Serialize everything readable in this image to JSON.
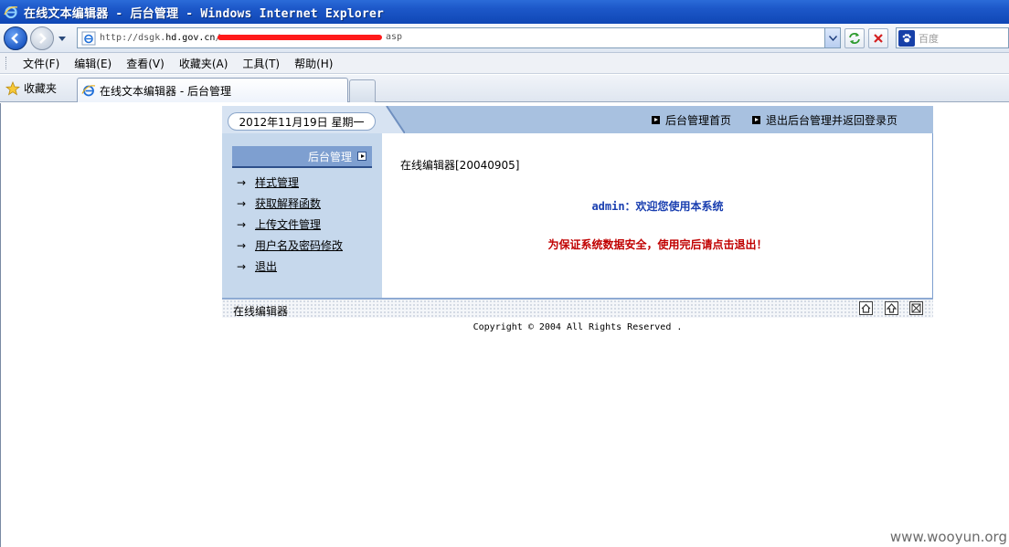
{
  "window": {
    "title": "在线文本编辑器 - 后台管理 - Windows Internet Explorer"
  },
  "address_bar": {
    "url_prefix": "http://dsgk.",
    "url_host": "hd.gov.cn",
    "url_slash": "/",
    "url_suffix": "asp",
    "search_placeholder": "百度"
  },
  "menu": {
    "items": [
      "文件(F)",
      "编辑(E)",
      "查看(V)",
      "收藏夹(A)",
      "工具(T)",
      "帮助(H)"
    ]
  },
  "tabs": {
    "favorites_label": "收藏夹",
    "active_tab_label": "在线文本编辑器 - 后台管理"
  },
  "page": {
    "date": "2012年11月19日  星期一",
    "top_links": {
      "home": "后台管理首页",
      "logout": "退出后台管理并返回登录页"
    },
    "sidebar": {
      "header": "后台管理",
      "items": [
        {
          "arrow": "→",
          "label": "样式管理"
        },
        {
          "arrow": "→",
          "label": "获取解释函数"
        },
        {
          "arrow": "→",
          "label": "上传文件管理"
        },
        {
          "arrow": "→",
          "label": "用户名及密码修改"
        },
        {
          "arrow": "→",
          "label": "退出"
        }
      ]
    },
    "main": {
      "version": "在线编辑器[20040905]",
      "welcome": "admin：欢迎您使用本系统",
      "warning": "为保证系统数据安全，使用完后请点击退出！"
    },
    "footer": {
      "name": "在线编辑器",
      "copyright": "Copyright © 2004 All Rights Reserved ."
    }
  },
  "watermark": "www.wooyun.org",
  "colors": {
    "titlebar": "#1d58c9",
    "welcome_text": "#1a3fb0",
    "warning_text": "#c00000",
    "redaction": "#ff1a1a"
  }
}
